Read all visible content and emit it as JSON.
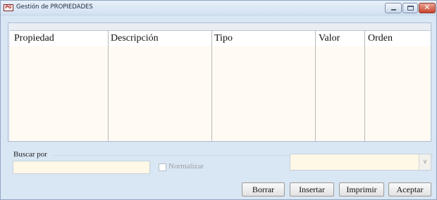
{
  "window": {
    "title": "Gestión de PROPIEDADES",
    "icon_text": "PG"
  },
  "grid": {
    "columns": [
      {
        "label": "Propiedad"
      },
      {
        "label": "Descripción"
      },
      {
        "label": "Tipo"
      },
      {
        "label": "Valor"
      },
      {
        "label": "Orden"
      }
    ],
    "rows": []
  },
  "search": {
    "group_label": "Buscar por",
    "input_value": "",
    "normalize_label": "Normalizar",
    "normalize_checked": false,
    "select_value": ""
  },
  "buttons": {
    "delete": "Borrar",
    "insert": "Insertar",
    "print": "Imprimir",
    "accept": "Aceptar"
  }
}
